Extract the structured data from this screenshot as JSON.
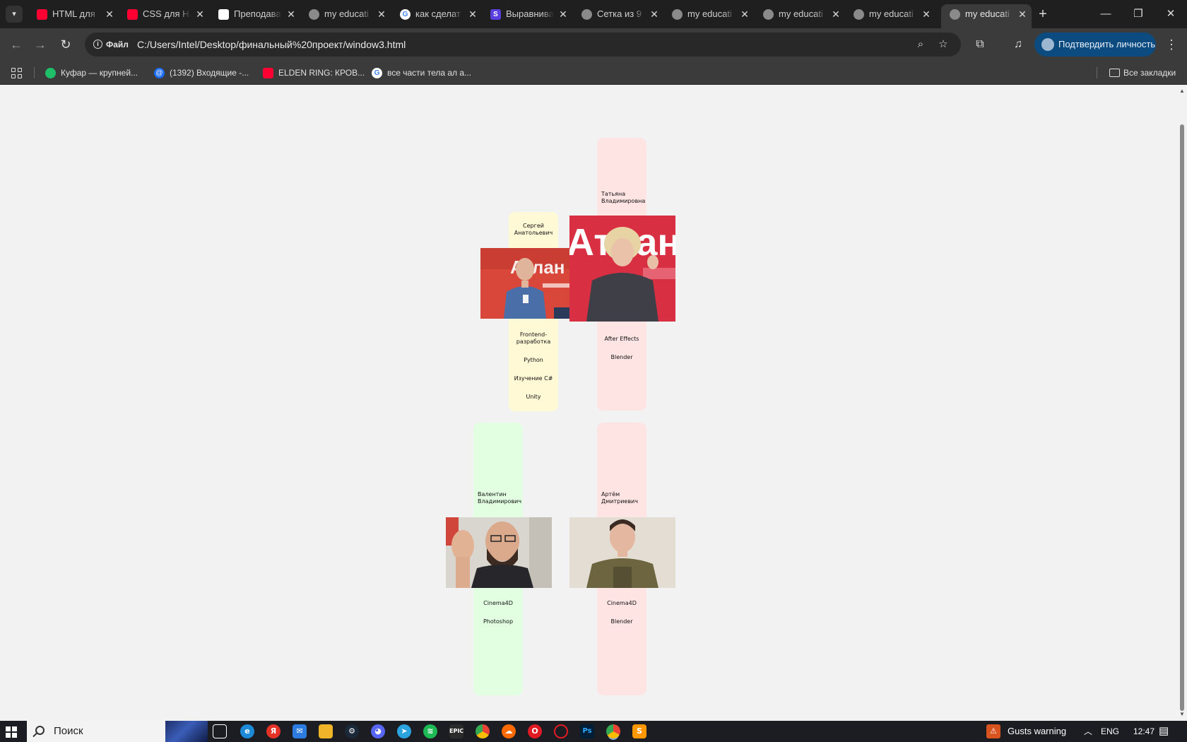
{
  "browser": {
    "tabs": [
      {
        "title": "HTML для",
        "icon": "youtube-icon",
        "color": "#ff0033"
      },
      {
        "title": "CSS для На",
        "icon": "youtube-icon",
        "color": "#ff0033"
      },
      {
        "title": "Преподава",
        "icon": "doc-icon",
        "color": "#ffffff"
      },
      {
        "title": "my educati",
        "icon": "globe-icon",
        "color": "#9a9a9a"
      },
      {
        "title": "как сделат",
        "icon": "google-icon",
        "color": "#ffffff"
      },
      {
        "title": "Выравнива",
        "icon": "s-icon",
        "color": "#5a3fe0"
      },
      {
        "title": "Сетка из 9",
        "icon": "globe-icon",
        "color": "#9a9a9a"
      },
      {
        "title": "my educati",
        "icon": "globe-icon",
        "color": "#9a9a9a"
      },
      {
        "title": "my educati",
        "icon": "globe-icon",
        "color": "#9a9a9a"
      },
      {
        "title": "my educati",
        "icon": "globe-icon",
        "color": "#9a9a9a"
      },
      {
        "title": "my educati",
        "icon": "globe-icon",
        "color": "#9a9a9a",
        "active": true
      }
    ],
    "new_tab": "+",
    "omnibox": {
      "badge": "Файл",
      "url": "C:/Users/Intel/Desktop/финальный%20проект/window3.html"
    },
    "profile_button": "Подтвердить личность",
    "bookmarks": [
      {
        "label": "Куфар — крупней...",
        "color": "#1fbf6a"
      },
      {
        "label": "(1392) Входящие -...",
        "color": "#1b6cf2"
      },
      {
        "label": "ELDEN RING: КРОВ...",
        "color": "#ff0033"
      },
      {
        "label": "все части тела ал а...",
        "color": "#ffffff"
      }
    ],
    "all_bookmarks": "Все закладки"
  },
  "teachers": [
    {
      "name_line1": "Татьяна",
      "name_line2": "Владимировна",
      "card_color": "#ffe4e4",
      "skills": [
        "After Effects",
        "Blender"
      ]
    },
    {
      "name_line1": "Сергей",
      "name_line2": "Анатольевич",
      "card_color": "#fff9d6",
      "skills": [
        "Frontend-",
        "разработка",
        "Python",
        "Изучение C#",
        "Unity"
      ]
    },
    {
      "name_line1": "Валентин",
      "name_line2": "Владимирович",
      "card_color": "#e2ffe2",
      "skills": [
        "Cinema4D",
        "Photoshop"
      ]
    },
    {
      "name_line1": "Артём",
      "name_line2": "Дмитриевич",
      "card_color": "#ffe4e4",
      "skills": [
        "Cinema4D",
        "Blender"
      ]
    }
  ],
  "photo_banner_text": "Атлан",
  "taskbar": {
    "search_placeholder": "Поиск",
    "weather": "Gusts warning",
    "lang": "ENG",
    "time": "12:47"
  }
}
